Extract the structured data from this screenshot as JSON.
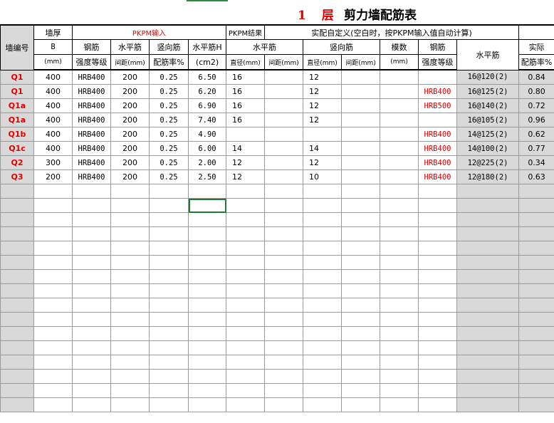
{
  "title": {
    "floor": "1 层",
    "name": "剪力墙配筋表"
  },
  "header": {
    "wall_id": "墙编号",
    "thickness": "墙厚",
    "thickness_symbol": "B",
    "thickness_unit": "(mm)",
    "pkpm_input": "PKPM输入",
    "steel": "钢筋",
    "steel_grade": "强度等级",
    "horiz_bar": "水平筋",
    "spacing_mm": "间距(mm)",
    "vert_bar": "竖向筋",
    "ratio_pct": "配筋率%",
    "pkpm_result": "PKPM结果",
    "horiz_bar_h": "水平筋H",
    "unit_cm2": "(cm2)",
    "custom": "实配自定义(空白时，按PKPM输入值自动计算)",
    "custom_horiz": "水平筋",
    "custom_vert": "竖向筋",
    "dia_mm": "直径(mm)",
    "gap_mm": "间距(mm)",
    "modulus": "模数",
    "modulus_unit": "(mm)",
    "steel2": "钢筋",
    "steel_grade2": "强度等级",
    "result_horiz": "水平筋",
    "actual": "实际",
    "actual_ratio": "配筋率%"
  },
  "rows": [
    [
      "Q1",
      "400",
      "HRB400",
      "200",
      "0.25",
      "6.50",
      "16",
      "",
      "12",
      "",
      "",
      "",
      "16@120(2)",
      "0.84"
    ],
    [
      "Q1",
      "400",
      "HRB400",
      "200",
      "0.25",
      "6.20",
      "16",
      "",
      "12",
      "",
      "",
      "HRB400",
      "16@125(2)",
      "0.80"
    ],
    [
      "Q1a",
      "400",
      "HRB400",
      "200",
      "0.25",
      "6.90",
      "16",
      "",
      "12",
      "",
      "",
      "HRB500",
      "16@140(2)",
      "0.72"
    ],
    [
      "Q1a",
      "400",
      "HRB400",
      "200",
      "0.25",
      "7.40",
      "16",
      "",
      "12",
      "",
      "",
      "",
      "16@105(2)",
      "0.96"
    ],
    [
      "Q1b",
      "400",
      "HRB400",
      "200",
      "0.25",
      "4.90",
      "",
      "",
      "",
      "",
      "",
      "HRB400",
      "14@125(2)",
      "0.62"
    ],
    [
      "Q1c",
      "400",
      "HRB400",
      "200",
      "0.25",
      "6.00",
      "14",
      "",
      "14",
      "",
      "",
      "HRB400",
      "14@100(2)",
      "0.77"
    ],
    [
      "Q2",
      "300",
      "HRB400",
      "200",
      "0.25",
      "2.00",
      "12",
      "",
      "12",
      "",
      "",
      "HRB400",
      "12@225(2)",
      "0.34"
    ],
    [
      "Q3",
      "200",
      "HRB400",
      "200",
      "0.25",
      "2.50",
      "12",
      "",
      "10",
      "",
      "",
      "HRB400",
      "12@180(2)",
      "0.63"
    ]
  ],
  "empty_row_count": 16,
  "selected_cell": {
    "row": 9,
    "col": 5
  },
  "colors": {
    "accent_red": "#e00000",
    "gray": "#d9d9d9",
    "selection": "#1e7b34"
  }
}
